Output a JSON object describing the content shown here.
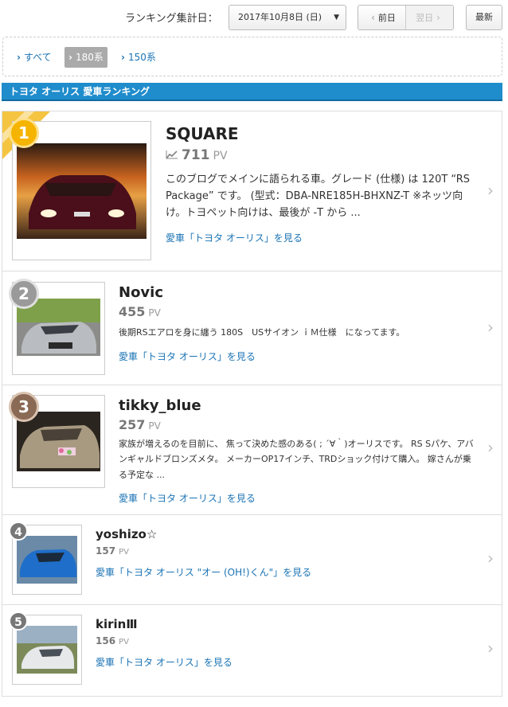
{
  "header": {
    "date_label": "ランキング集計日：",
    "date_value": "2017年10月8日 (日)",
    "prev_label": "前日",
    "next_label": "翌日",
    "latest_label": "最新"
  },
  "filters": [
    {
      "label": "すべて",
      "active": false
    },
    {
      "label": "180系",
      "active": true
    },
    {
      "label": "150系",
      "active": false
    }
  ],
  "section_title": "トヨタ オーリス 愛車ランキング",
  "colors": {
    "accent": "#1f8ccc",
    "link": "#1a73b5",
    "gold": "#f5b400",
    "silver": "#9a9a9a",
    "bronze": "#8a6a55"
  },
  "ranking": [
    {
      "rank": "1",
      "user": "SQUARE",
      "pv": "711",
      "pv_unit": "PV",
      "trend_icon": "trend-up-icon",
      "description": "このブログでメインに語られる車。グレード (仕様) は 120T “RS Package” です。 (型式：DBA-NRE185H-BHXNZ-T ※ネッツ向け。トヨペット向けは、最後が -T から ...",
      "car_link": "愛車「トヨタ オーリス」を見る"
    },
    {
      "rank": "2",
      "user": "Novic",
      "pv": "455",
      "pv_unit": "PV",
      "description": "後期RSエアロを身に纏う 180S　USサイオン ｉＭ仕様　になってます。",
      "car_link": "愛車「トヨタ オーリス」を見る"
    },
    {
      "rank": "3",
      "user": "tikky_blue",
      "pv": "257",
      "pv_unit": "PV",
      "description": "家族が増えるのを目前に、 焦って決めた感のある( ; ´∀｀)オーリスです。 RS Sパケ、アバンギャルドブロンズメタ。 メーカーOP17インチ、TRDショック付けて購入。 嫁さんが乗る予定な ...",
      "car_link": "愛車「トヨタ オーリス」を見る"
    },
    {
      "rank": "4",
      "user": "yoshizo☆",
      "pv": "157",
      "pv_unit": "PV",
      "car_link": "愛車「トヨタ オーリス \"オー (OH!)くん\"」を見る"
    },
    {
      "rank": "5",
      "user": "kirinⅢ",
      "pv": "156",
      "pv_unit": "PV",
      "car_link": "愛車「トヨタ オーリス」を見る"
    }
  ]
}
